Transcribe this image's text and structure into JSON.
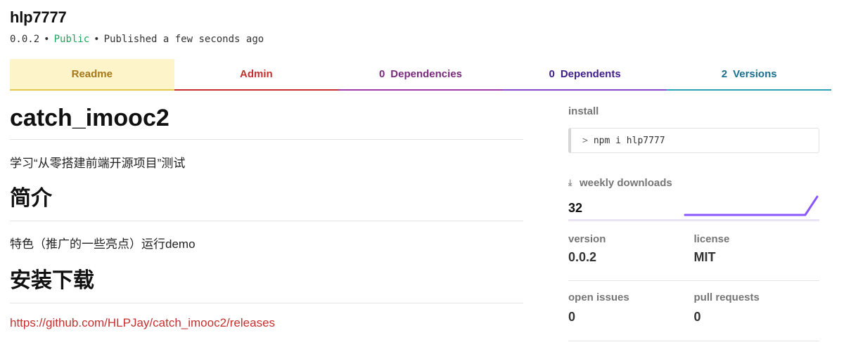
{
  "package": {
    "name": "hlp7777",
    "version": "0.0.2",
    "visibility": "Public",
    "published": "Published a few seconds ago",
    "separator": "•"
  },
  "tabs": [
    {
      "label": "Readme",
      "count": ""
    },
    {
      "label": "Admin",
      "count": ""
    },
    {
      "label": "Dependencies",
      "count": "0"
    },
    {
      "label": "Dependents",
      "count": "0"
    },
    {
      "label": "Versions",
      "count": "2"
    }
  ],
  "readme": {
    "title": "catch_imooc2",
    "description": "学习“从零搭建前端开源项目”测试",
    "section1_heading": "简介",
    "section1_text": "特色（推广的一些亮点）运行demo",
    "section2_heading": "安装下载",
    "section2_link": "https://github.com/HLPJay/catch_imooc2/releases"
  },
  "sidebar": {
    "install_label": "install",
    "install_command": "npm i hlp7777",
    "install_prompt": ">",
    "weekly_downloads_label": "weekly downloads",
    "weekly_downloads_icon": "download-arrow-icon",
    "weekly_downloads": "32",
    "sparkline": [
      0,
      0,
      0,
      0,
      0,
      0,
      0,
      0,
      0,
      0,
      0,
      1
    ],
    "sparkline_color": "#8956ff",
    "stats": [
      {
        "label": "version",
        "value": "0.0.2"
      },
      {
        "label": "license",
        "value": "MIT"
      },
      {
        "label": "open issues",
        "value": "0"
      },
      {
        "label": "pull requests",
        "value": "0"
      }
    ]
  }
}
